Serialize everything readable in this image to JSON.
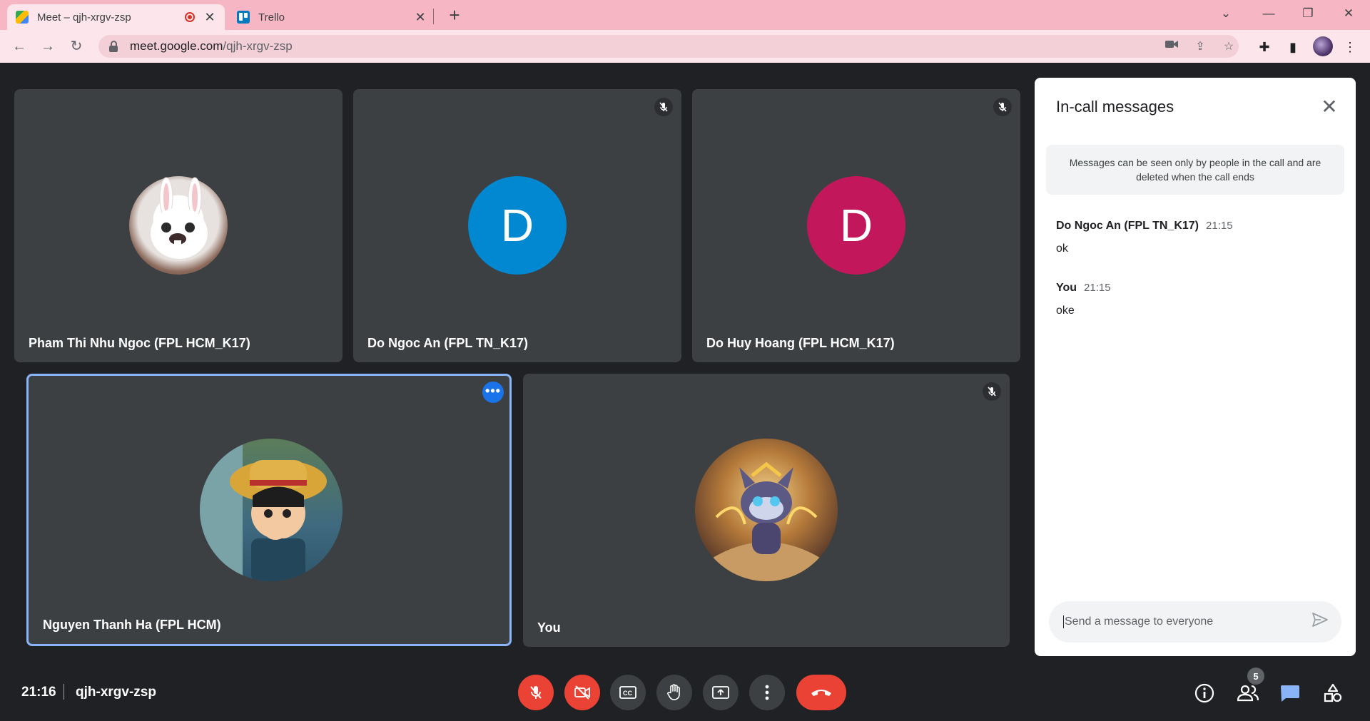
{
  "browser": {
    "tabs": [
      {
        "title": "Meet – qjh-xrgv-zsp",
        "active": true
      },
      {
        "title": "Trello",
        "active": false
      }
    ],
    "url_domain": "meet.google.com",
    "url_path": "/qjh-xrgv-zsp",
    "icons": {
      "back": "back-arrow-icon",
      "forward": "forward-arrow-icon",
      "reload": "reload-icon"
    }
  },
  "tiles": [
    {
      "name": "Pham Thi Nhu Ngoc (FPL HCM_K17)",
      "avatar": "bunny-photo",
      "muted": false
    },
    {
      "name": "Do Ngoc An (FPL TN_K17)",
      "avatar_letter": "D",
      "avatar_color": "#0288d1",
      "muted": true
    },
    {
      "name": "Do Huy Hoang (FPL HCM_K17)",
      "avatar_letter": "D",
      "avatar_color": "#c2185b",
      "muted": true
    },
    {
      "name": "Nguyen Thanh Ha (FPL HCM)",
      "avatar": "cartoon-boy-photo",
      "muted": false,
      "pinned_highlight": true
    },
    {
      "name": "You",
      "avatar": "cat-photo",
      "muted": true
    }
  ],
  "chat": {
    "title": "In-call messages",
    "notice": "Messages can be seen only by people in the call and are deleted when the call ends",
    "messages": [
      {
        "sender": "Do Ngoc An (FPL TN_K17)",
        "time": "21:15",
        "text": "ok"
      },
      {
        "sender": "You",
        "time": "21:15",
        "text": "oke"
      }
    ],
    "input_placeholder": "Send a message to everyone"
  },
  "bottom_bar": {
    "time": "21:16",
    "meeting_code": "qjh-xrgv-zsp",
    "people_count": "5"
  },
  "colors": {
    "accent": "#1a73e8",
    "danger": "#ea4335",
    "tab_bar": "#f7b6c4"
  }
}
